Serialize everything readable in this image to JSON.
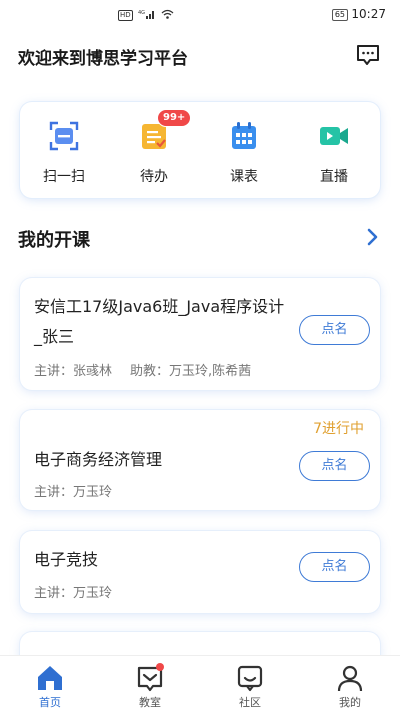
{
  "status_bar": {
    "network_label": "HD",
    "signal_label": "4G",
    "battery": "65",
    "time": "10:27"
  },
  "header": {
    "title": "欢迎来到博思学习平台",
    "message_icon": "chat-bubble-icon"
  },
  "quick_actions": [
    {
      "label": "扫一扫",
      "icon": "scan-icon"
    },
    {
      "label": "待办",
      "icon": "todo-icon",
      "badge": "99+"
    },
    {
      "label": "课表",
      "icon": "calendar-icon"
    },
    {
      "label": "直播",
      "icon": "live-video-icon"
    }
  ],
  "section": {
    "title": "我的开课",
    "arrow_icon": "chevron-right-icon"
  },
  "courses": [
    {
      "name": "安信工17级Java6班_Java程序设计_张三",
      "lecturer": "主讲：张彧林",
      "assistant": "助教：万玉玲,陈希茜",
      "button": "点名"
    },
    {
      "status": "7进行中",
      "name": "电子商务经济管理",
      "lecturer": "主讲：万玉玲",
      "button": "点名"
    },
    {
      "name": "电子竞技",
      "lecturer": "主讲：万玉玲",
      "button": "点名"
    }
  ],
  "tabs": [
    {
      "label": "首页",
      "icon": "home-icon",
      "active": true
    },
    {
      "label": "教室",
      "icon": "classroom-icon",
      "dot": true
    },
    {
      "label": "社区",
      "icon": "community-icon"
    },
    {
      "label": "我的",
      "icon": "profile-icon"
    }
  ],
  "colors": {
    "accent": "#2f6fd1",
    "badge": "#f04848",
    "status": "#e0a030"
  }
}
